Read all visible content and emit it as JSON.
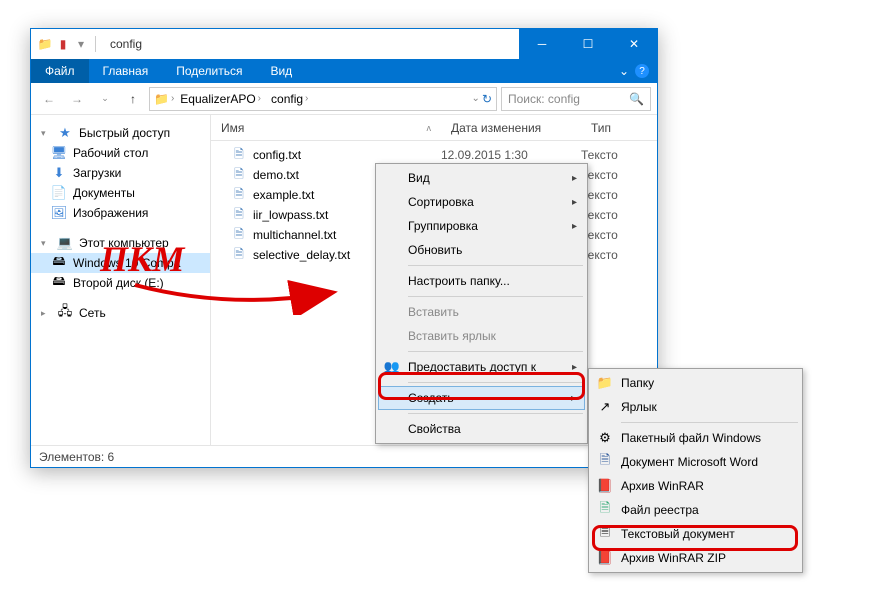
{
  "window": {
    "title": "config",
    "tabs": {
      "file": "Файл",
      "home": "Главная",
      "share": "Поделиться",
      "view": "Вид"
    }
  },
  "addr": {
    "segs": [
      "EqualizerAPO",
      "config"
    ],
    "search_placeholder": "Поиск: config"
  },
  "nav": {
    "quick": "Быстрый доступ",
    "desktop": "Рабочий стол",
    "downloads": "Загрузки",
    "documents": "Документы",
    "pictures": "Изображения",
    "thispc": "Этот компьютер",
    "win10": "Windows 10 Compa",
    "disk2": "Второй диск (E:)",
    "network": "Сеть"
  },
  "cols": {
    "name": "Имя",
    "date": "Дата изменения",
    "type": "Тип"
  },
  "files": [
    {
      "name": "config.txt",
      "date": "12.09.2015 1:30",
      "type": "Тексто"
    },
    {
      "name": "demo.txt",
      "date": "",
      "type": "Тексто"
    },
    {
      "name": "example.txt",
      "date": "",
      "type": "Тексто"
    },
    {
      "name": "iir_lowpass.txt",
      "date": "",
      "type": "Тексто"
    },
    {
      "name": "multichannel.txt",
      "date": "",
      "type": "Тексто"
    },
    {
      "name": "selective_delay.txt",
      "date": "",
      "type": "Тексто"
    }
  ],
  "status": {
    "count": "Элементов: 6"
  },
  "ctx1": {
    "view": "Вид",
    "sort": "Сортировка",
    "group": "Группировка",
    "refresh": "Обновить",
    "customize": "Настроить папку...",
    "paste": "Вставить",
    "paste_shortcut": "Вставить ярлык",
    "share": "Предоставить доступ к",
    "create": "Создать",
    "properties": "Свойства"
  },
  "ctx2": {
    "folder": "Папку",
    "shortcut": "Ярлык",
    "batfile": "Пакетный файл Windows",
    "worddoc": "Документ Microsoft Word",
    "winrar": "Архив WinRAR",
    "regfile": "Файл реестра",
    "textdoc": "Текстовый документ",
    "winrarzip": "Архив WinRAR ZIP"
  },
  "annot": {
    "pkm": "ПКМ"
  }
}
